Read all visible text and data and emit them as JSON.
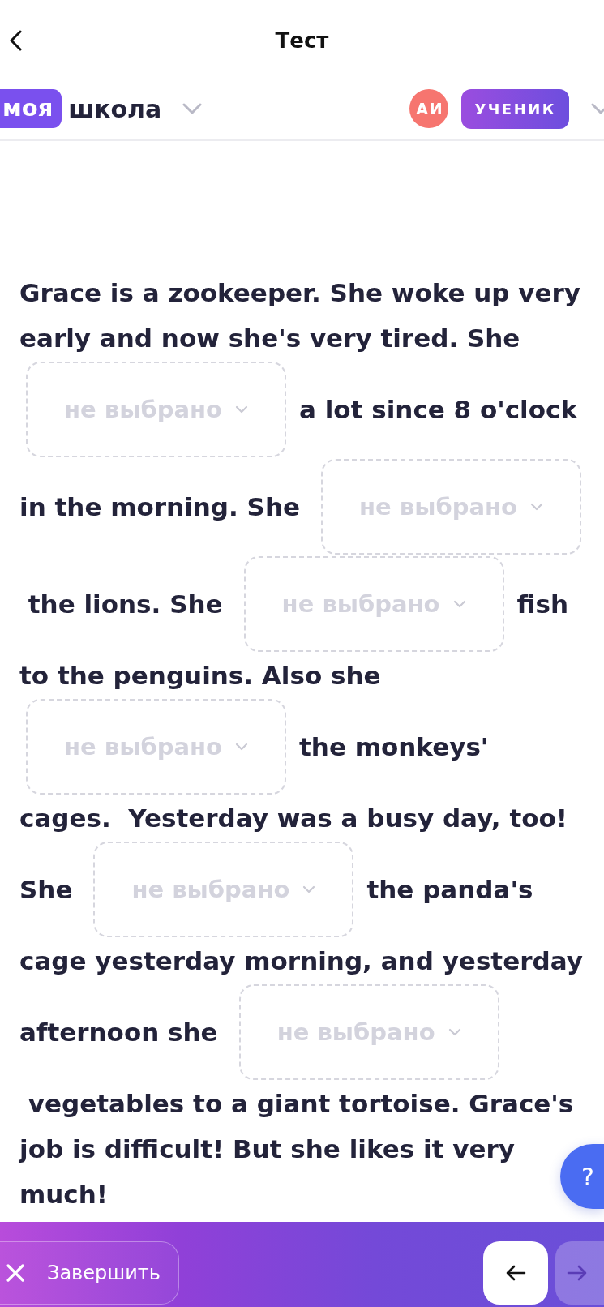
{
  "header": {
    "title": "Тест"
  },
  "school": {
    "badge": "моя",
    "name": "школа"
  },
  "user": {
    "initials": "АИ",
    "role": "УЧЕНИК"
  },
  "passage": {
    "lines": [
      [
        {
          "kind": "text",
          "text": "Grace is a zookeeper. She woke up very"
        }
      ],
      [
        {
          "kind": "text",
          "text": "early and now she's very tired. She"
        }
      ],
      [
        {
          "kind": "select",
          "placeholder": "не выбрано"
        },
        {
          "kind": "text",
          "text": "a lot since 8 o'clock"
        }
      ],
      [
        {
          "kind": "text",
          "text": "in the morning. She"
        },
        {
          "kind": "select",
          "placeholder": "не выбрано"
        }
      ],
      [
        {
          "kind": "text",
          "text": " the lions. She"
        },
        {
          "kind": "select",
          "placeholder": "не выбрано"
        },
        {
          "kind": "text",
          "text": "fish"
        }
      ],
      [
        {
          "kind": "text",
          "text": "to the penguins. Also she"
        }
      ],
      [
        {
          "kind": "select",
          "placeholder": "не выбрано"
        },
        {
          "kind": "text",
          "text": "the monkeys'"
        }
      ],
      [
        {
          "kind": "text",
          "text": "cages.  Yesterday was a busy day, too!"
        }
      ],
      [
        {
          "kind": "text",
          "text": "She"
        },
        {
          "kind": "select",
          "placeholder": "не выбрано"
        },
        {
          "kind": "text",
          "text": "the panda's"
        }
      ],
      [
        {
          "kind": "text",
          "text": "cage yesterday morning, and yesterday"
        }
      ],
      [
        {
          "kind": "text",
          "text": "afternoon she"
        },
        {
          "kind": "select",
          "placeholder": "не выбрано"
        }
      ],
      [
        {
          "kind": "text",
          "text": " vegetables to a giant tortoise. Grace's"
        }
      ],
      [
        {
          "kind": "text",
          "text": "job is difficult! But she likes it very"
        }
      ],
      [
        {
          "kind": "text",
          "text": "much!"
        }
      ]
    ]
  },
  "help_button": {
    "label": "?"
  },
  "footer": {
    "finish_label": "Завершить",
    "nav_buttons": [
      {
        "kind": "back",
        "disabled": false
      },
      {
        "kind": "next",
        "disabled": true
      }
    ]
  }
}
